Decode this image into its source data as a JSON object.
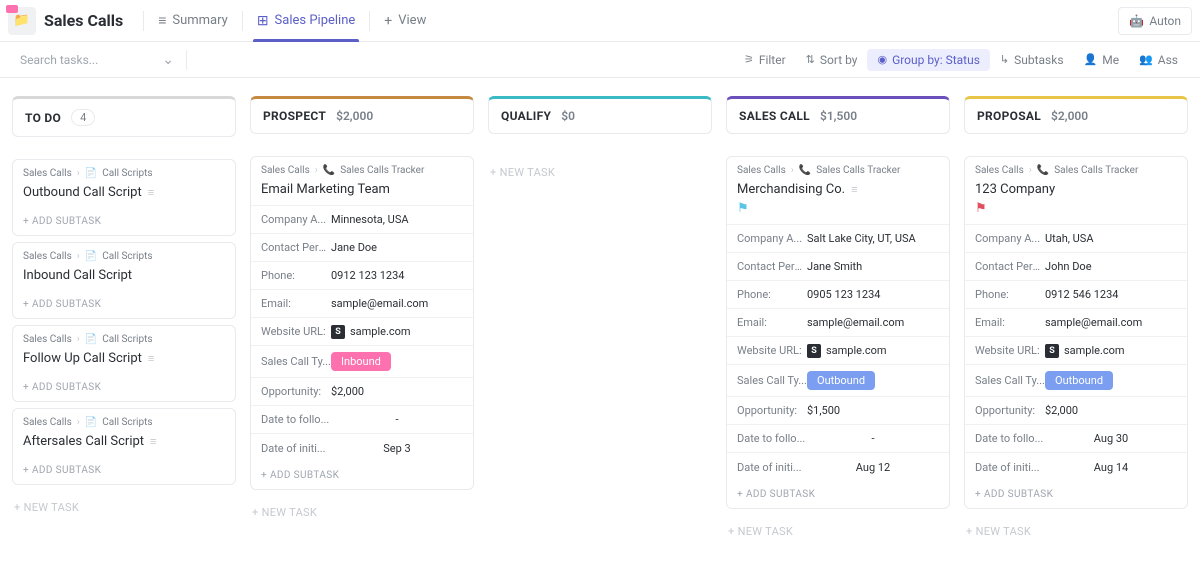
{
  "header": {
    "title": "Sales Calls",
    "tabs": [
      {
        "label": "Summary",
        "icon": "≡"
      },
      {
        "label": "Sales Pipeline",
        "icon": "⊞"
      },
      {
        "label": "View",
        "icon": "+"
      }
    ],
    "autoButton": "Auton"
  },
  "toolbar": {
    "searchPlaceholder": "Search tasks...",
    "filter": "Filter",
    "sortBy": "Sort by",
    "groupBy": "Group by: Status",
    "subtasks": "Subtasks",
    "me": "Me",
    "assignee": "Ass"
  },
  "columns": {
    "todo": {
      "name": "TO DO",
      "count": "4",
      "color": "#d8d8d8"
    },
    "prospect": {
      "name": "PROSPECT",
      "value": "$2,000",
      "color": "#c58a3f"
    },
    "qualify": {
      "name": "QUALIFY",
      "value": "$0",
      "color": "#3abac3"
    },
    "salesCall": {
      "name": "SALES CALL",
      "value": "$1,500",
      "color": "#6b4fbb"
    },
    "proposal": {
      "name": "PROPOSAL",
      "value": "$2,000",
      "color": "#e8c547"
    }
  },
  "labels": {
    "addSubtask": "+ ADD SUBTASK",
    "newTask": "+ NEW TASK",
    "breadcrumbRoot": "Sales Calls",
    "breadcrumbScripts": "Call Scripts",
    "breadcrumbTracker": "Sales Calls Tracker",
    "companyAddress": "Company A...",
    "contactPerson": "Contact Pers...",
    "phone": "Phone:",
    "email": "Email:",
    "websiteUrl": "Website URL:",
    "salesCallType": "Sales Call Ty...",
    "opportunity": "Opportunity:",
    "dateFollow": "Date to follo...",
    "dateInit": "Date of initi..."
  },
  "todoCards": [
    {
      "title": "Outbound Call Script"
    },
    {
      "title": "Inbound Call Script"
    },
    {
      "title": "Follow Up Call Script"
    },
    {
      "title": "Aftersales Call Script"
    }
  ],
  "prospectCard": {
    "title": "Email Marketing Team",
    "address": "Minnesota, USA",
    "contact": "Jane Doe",
    "phone": "0912 123 1234",
    "email": "sample@email.com",
    "website": "sample.com",
    "callType": "Inbound",
    "opportunity": "$2,000",
    "dateFollow": "-",
    "dateInit": "Sep 3"
  },
  "salesCallCard": {
    "title": "Merchandising Co.",
    "flag": "cyan",
    "address": "Salt Lake City, UT, USA",
    "contact": "Jane Smith",
    "phone": "0905 123 1234",
    "email": "sample@email.com",
    "website": "sample.com",
    "callType": "Outbound",
    "opportunity": "$1,500",
    "dateFollow": "-",
    "dateInit": "Aug 12"
  },
  "proposalCard": {
    "title": "123 Company",
    "flag": "red",
    "address": "Utah, USA",
    "contact": "John Doe",
    "phone": "0912 546 1234",
    "email": "sample@email.com",
    "website": "sample.com",
    "callType": "Outbound",
    "opportunity": "$2,000",
    "dateFollow": "Aug 30",
    "dateInit": "Aug 14"
  }
}
